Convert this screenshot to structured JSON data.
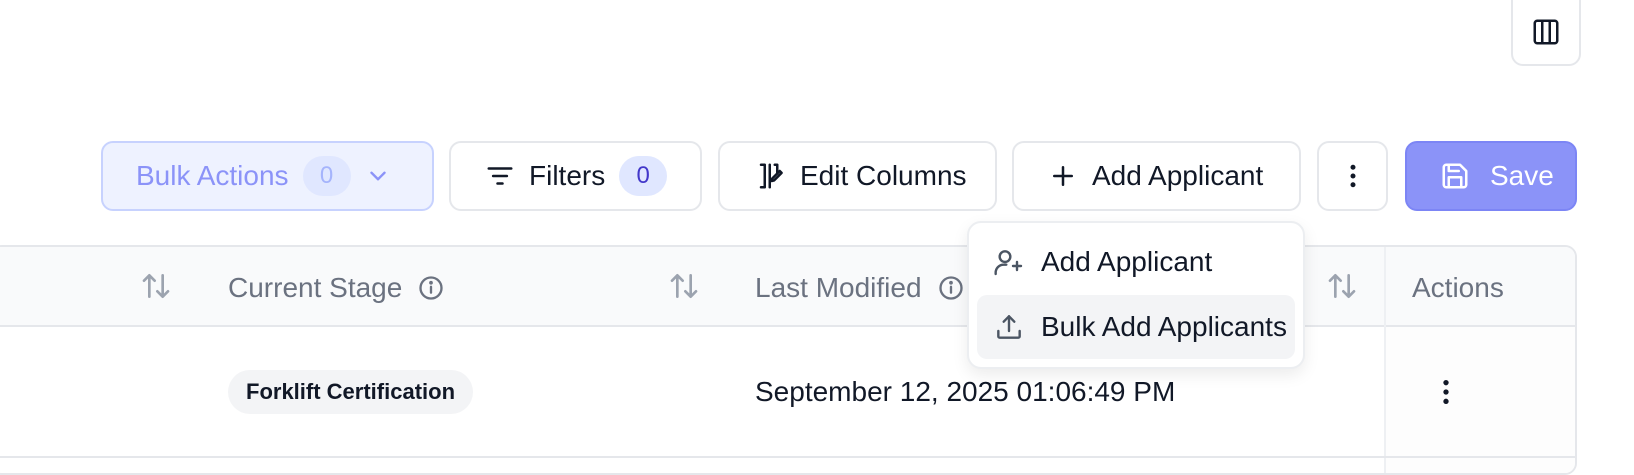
{
  "toolbar": {
    "bulk_actions_label": "Bulk Actions",
    "bulk_actions_count": "0",
    "filters_label": "Filters",
    "filters_count": "0",
    "edit_columns_label": "Edit Columns",
    "add_applicant_label": "Add Applicant",
    "save_label": "Save"
  },
  "dropdown": {
    "items": [
      {
        "label": "Add Applicant",
        "icon": "user-plus-icon"
      },
      {
        "label": "Bulk Add Applicants",
        "icon": "upload-icon"
      }
    ]
  },
  "table": {
    "headers": {
      "current_stage": "Current Stage",
      "last_modified": "Last Modified",
      "actions": "Actions"
    },
    "rows": [
      {
        "current_stage": "Forklift Certification",
        "last_modified": "September 12, 2025 01:06:49 PM"
      }
    ]
  },
  "colors": {
    "accent": "#8b93f8",
    "accent_light": "#eef2ff",
    "badge_text": "#4338ca"
  }
}
